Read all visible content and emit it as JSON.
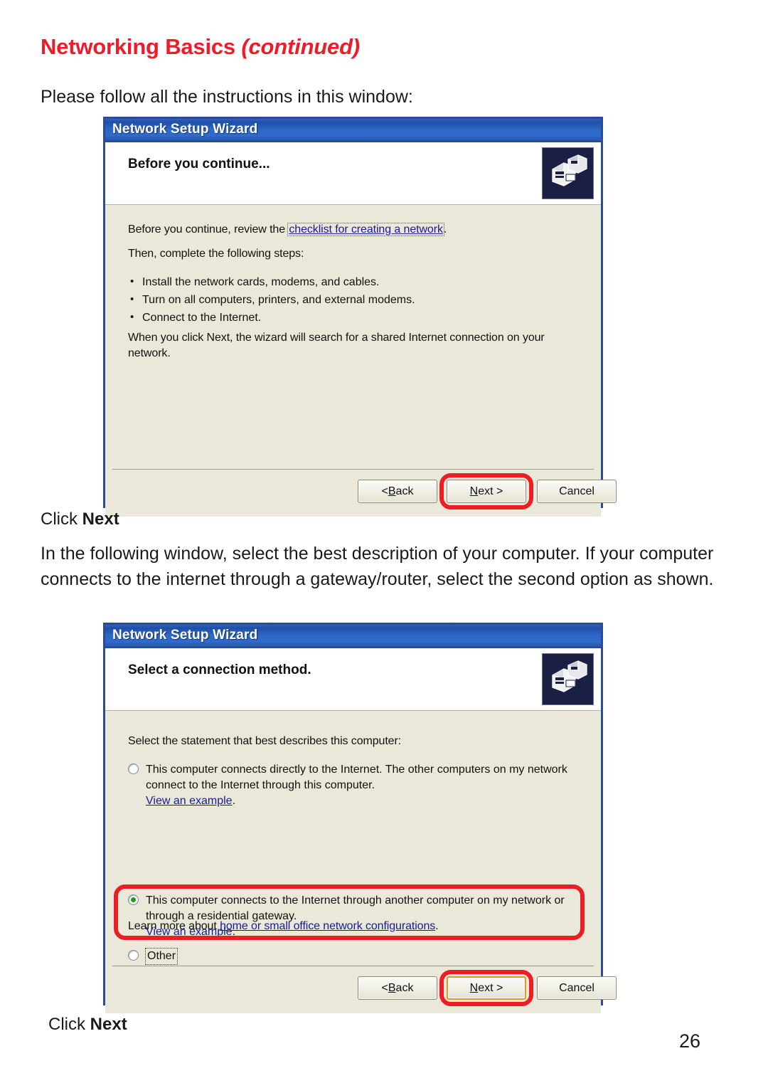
{
  "page": {
    "heading_main": "Networking Basics ",
    "heading_continued": "(continued)",
    "intro": "Please follow all the instructions in this window:",
    "click_next_prefix_1": "Click ",
    "click_next_bold_1": "Next",
    "paragraph_two": "In the following window, select the best description of your computer.  If your computer connects to the internet through a gateway/router, select the second option as shown.",
    "click_next_prefix_2": "Click ",
    "click_next_bold_2": "Next",
    "page_number": "26",
    "accent_red": "#ee1c28",
    "link_blue": "#1a1a9c",
    "wizard_beige": "#e9e8d9",
    "titlebar_blue": "#2d67c4"
  },
  "wizard_one": {
    "title": "Network Setup Wizard",
    "header_title": "Before you continue...",
    "icon_name": "network-computers-icon",
    "line1_before": "Before you continue, review the ",
    "line1_link": "checklist for creating a network",
    "line1_after": ".",
    "line2": "Then, complete the following steps:",
    "steps": [
      "Install the network cards, modems, and cables.",
      "Turn on all computers, printers, and external modems.",
      "Connect to the Internet."
    ],
    "line3": "When you click Next, the wizard will search for a shared Internet connection on your network.",
    "buttons": {
      "back_prefix": "< ",
      "back_underline": "B",
      "back_suffix": "ack",
      "next_underline": "N",
      "next_suffix": "ext >",
      "cancel": "Cancel"
    }
  },
  "wizard_two": {
    "title": "Network Setup Wizard",
    "header_title": "Select a connection method.",
    "icon_name": "network-computers-icon",
    "prompt": "Select the statement that best describes this computer:",
    "options": [
      {
        "selected": false,
        "label": "This computer connects directly to the Internet. The other computers on my network connect to the Internet through this computer.",
        "link": "View an example",
        "link_suffix": "."
      },
      {
        "selected": true,
        "label": "This computer connects to the Internet through another computer on my network or through a residential gateway.",
        "link": "View an example",
        "link_suffix": "."
      },
      {
        "selected": false,
        "label": "Other",
        "link": "",
        "link_suffix": ""
      }
    ],
    "learn_more_before": "Learn more about ",
    "learn_more_link": "home or small office network configurations",
    "learn_more_after": ".",
    "buttons": {
      "back_prefix": "< ",
      "back_underline": "B",
      "back_suffix": "ack",
      "next_underline": "N",
      "next_suffix": "ext >",
      "cancel": "Cancel"
    }
  }
}
